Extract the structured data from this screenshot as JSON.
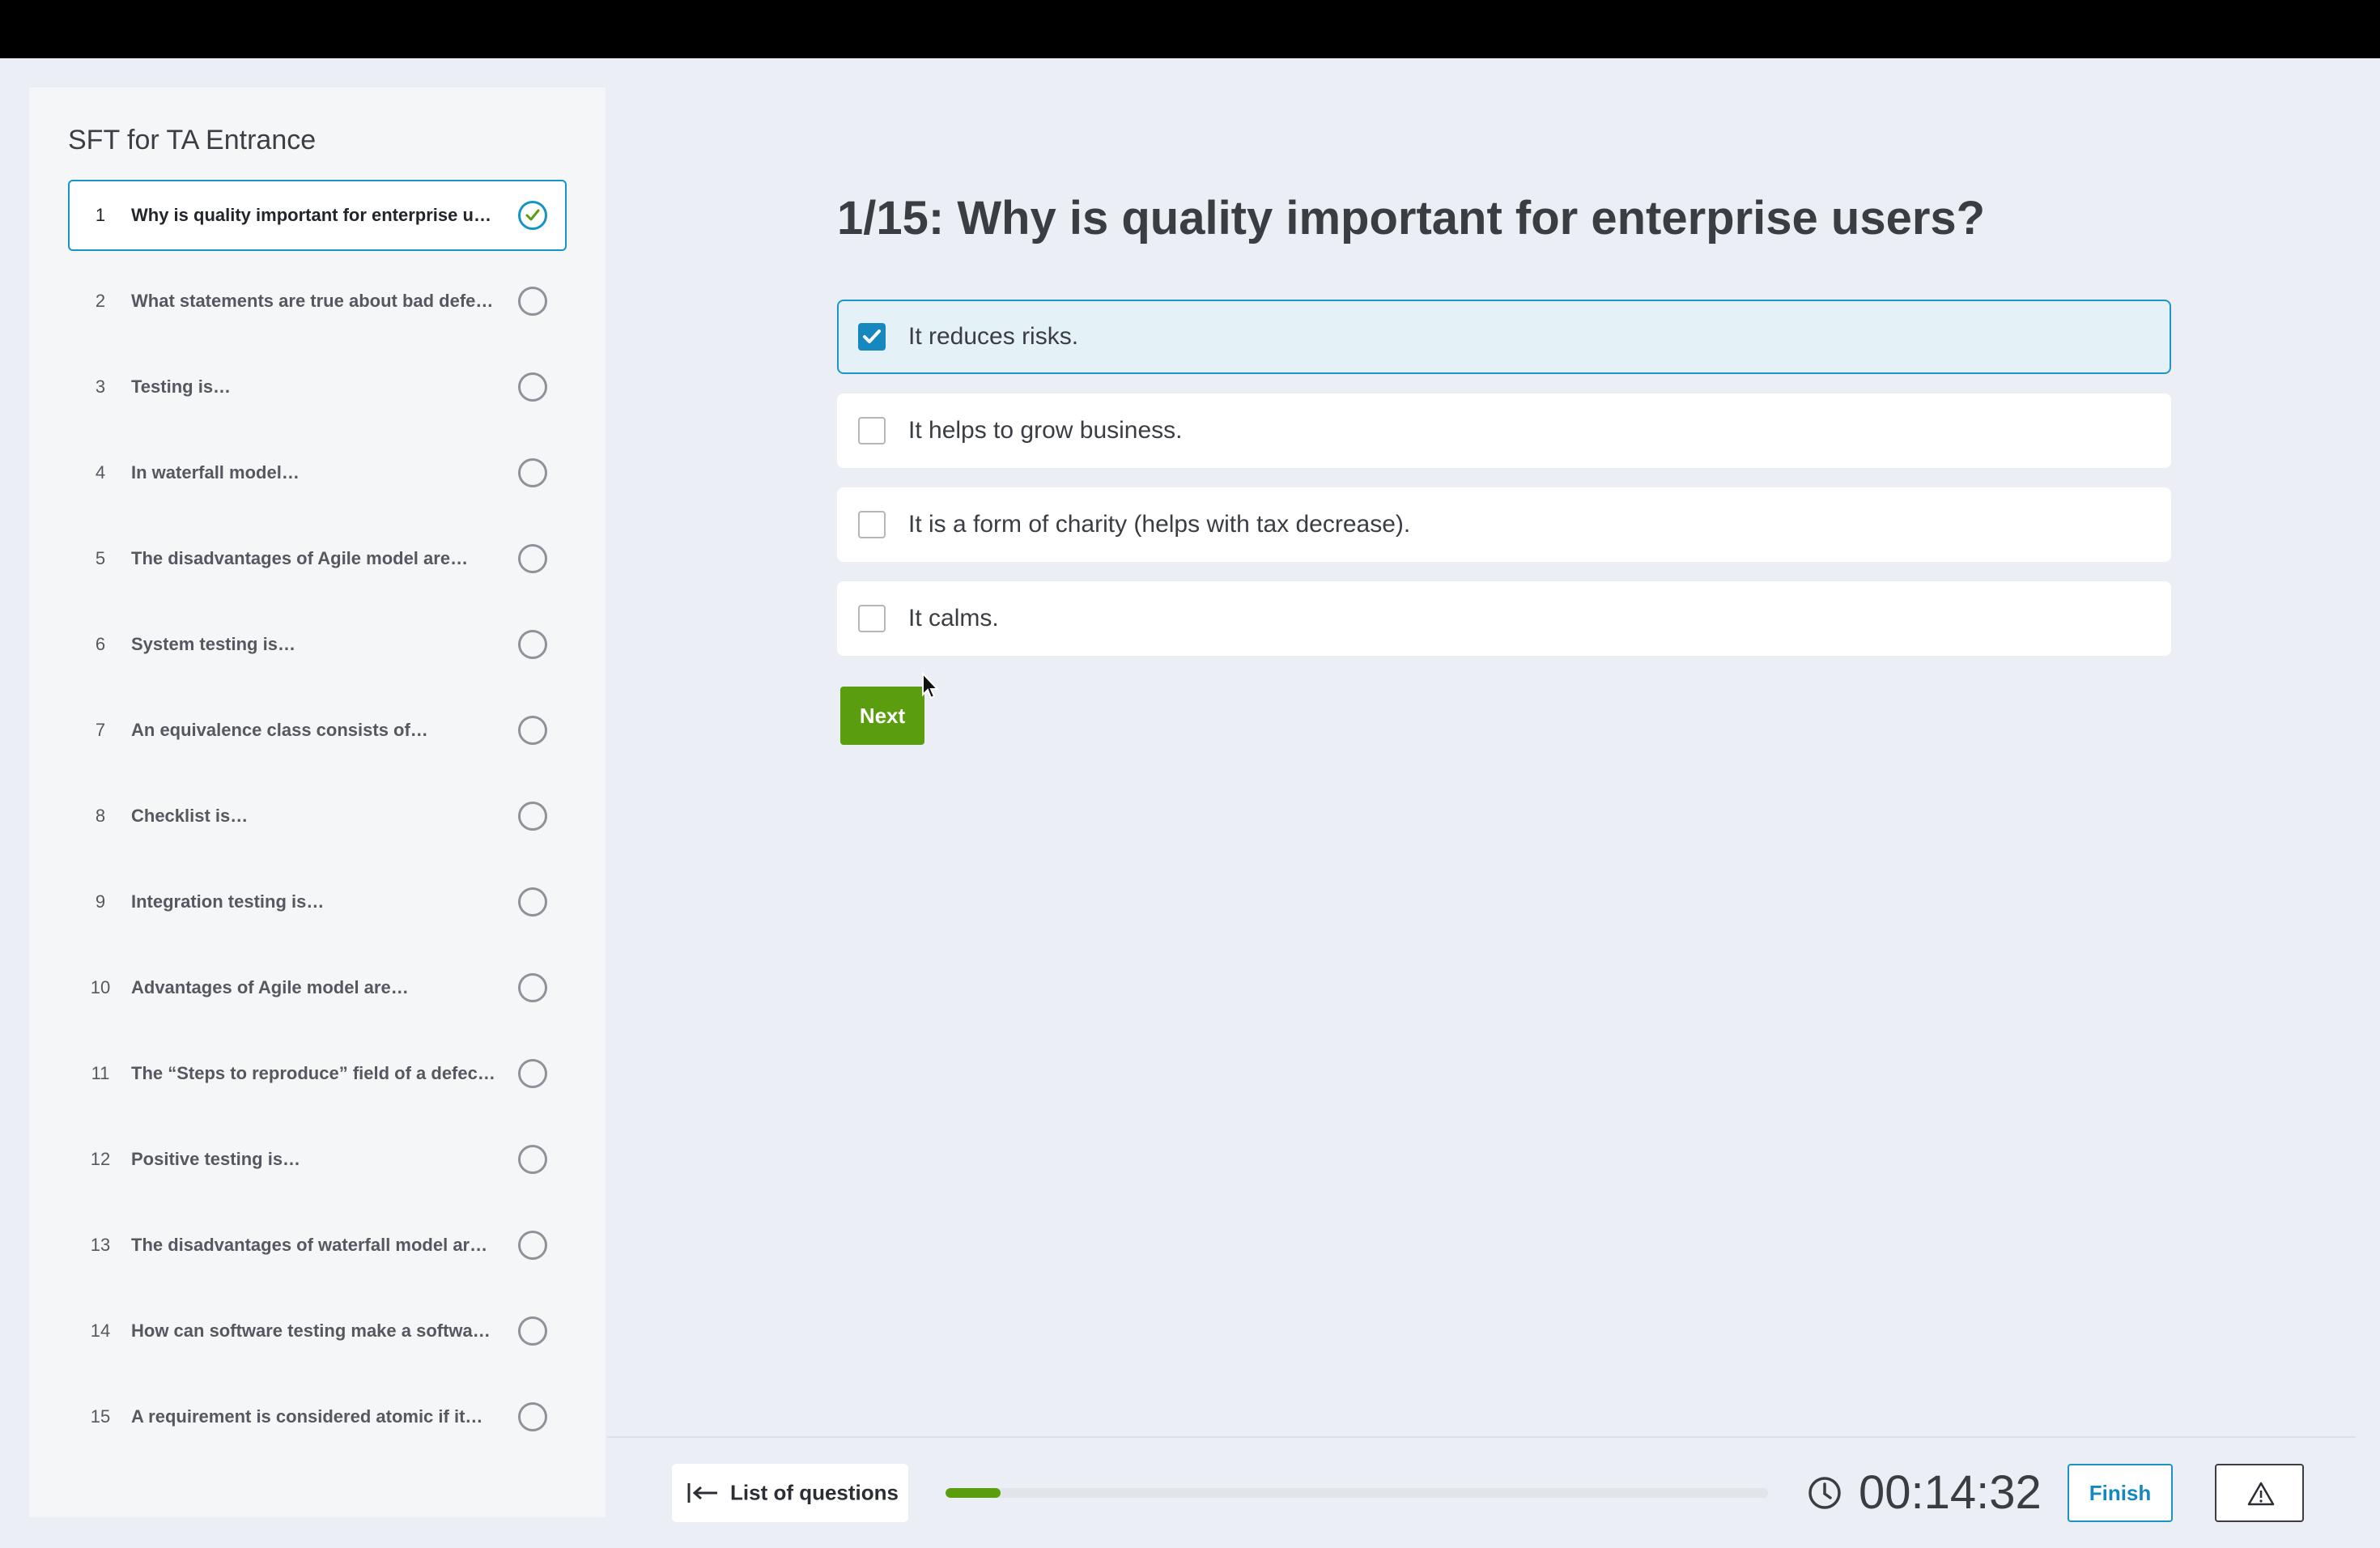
{
  "sidebar": {
    "title": "SFT for TA Entrance",
    "questions": [
      {
        "num": "1",
        "text": "Why is quality important for enterprise users?",
        "answered": true
      },
      {
        "num": "2",
        "text": "What statements are true about bad defects?",
        "answered": false
      },
      {
        "num": "3",
        "text": "Testing is…",
        "answered": false
      },
      {
        "num": "4",
        "text": "In waterfall model…",
        "answered": false
      },
      {
        "num": "5",
        "text": "The disadvantages of Agile model are…",
        "answered": false
      },
      {
        "num": "6",
        "text": "System testing is…",
        "answered": false
      },
      {
        "num": "7",
        "text": "An equivalence class consists of…",
        "answered": false
      },
      {
        "num": "8",
        "text": "Checklist is…",
        "answered": false
      },
      {
        "num": "9",
        "text": "Integration testing is…",
        "answered": false
      },
      {
        "num": "10",
        "text": "Advantages of Agile model are…",
        "answered": false
      },
      {
        "num": "11",
        "text": "The “Steps to reproduce” field of a defect report…",
        "answered": false
      },
      {
        "num": "12",
        "text": "Positive testing is…",
        "answered": false
      },
      {
        "num": "13",
        "text": "The disadvantages of waterfall model are…",
        "answered": false
      },
      {
        "num": "14",
        "text": "How can software testing make a software…",
        "answered": false
      },
      {
        "num": "15",
        "text": "A requirement is considered atomic if it…",
        "answered": false
      }
    ]
  },
  "main": {
    "question_title": "1/15: Why is quality important for enterprise users?",
    "options": [
      {
        "label": "It reduces risks.",
        "checked": true
      },
      {
        "label": "It helps to grow business.",
        "checked": false
      },
      {
        "label": "It is a form of charity (helps with tax decrease).",
        "checked": false
      },
      {
        "label": "It calms.",
        "checked": false
      }
    ],
    "next_label": "Next"
  },
  "footer": {
    "list_label": "List of questions",
    "list_icon": "arrow-left-to-bar-icon",
    "progress_fraction": 0.0667,
    "timer": "00:14:32",
    "timer_icon": "clock-icon",
    "finish_label": "Finish",
    "report_icon": "warning-triangle-icon"
  },
  "colors": {
    "accent": "#1588c0",
    "success": "#5a9e0f",
    "background": "#ebeef4"
  }
}
